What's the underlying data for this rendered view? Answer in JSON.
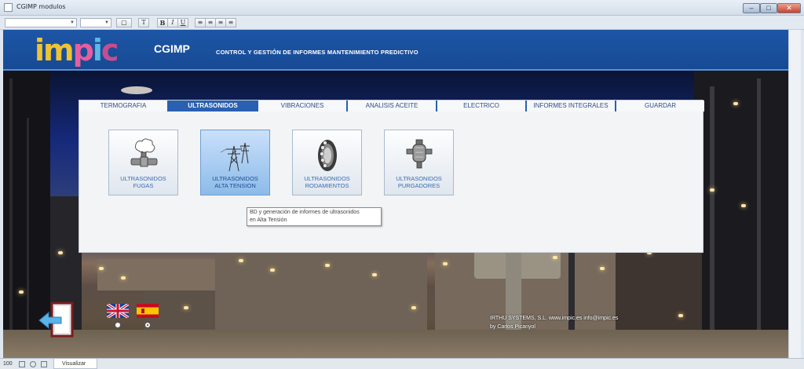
{
  "window": {
    "title": "CGIMP modulos"
  },
  "header": {
    "logo_parts": [
      "im",
      "p",
      "i",
      "c"
    ],
    "app_name": "CGIMP",
    "subtitle": "CONTROL Y GESTIÓN DE INFORMES MANTENIMIENTO PREDICTIVO"
  },
  "tabs": [
    {
      "label": "TERMOGRAFIA",
      "active": false
    },
    {
      "label": "ULTRASONIDOS",
      "active": true
    },
    {
      "label": "VIBRACIONES",
      "active": false
    },
    {
      "label": "ANALISIS ACEITE",
      "active": false
    },
    {
      "label": "ELECTRICO",
      "active": false
    },
    {
      "label": "INFORMES INTEGRALES",
      "active": false
    },
    {
      "label": "GUARDAR",
      "active": false
    }
  ],
  "tiles": [
    {
      "line1": "ULTRASONIDOS",
      "line2": "FUGAS",
      "icon": "leak-icon"
    },
    {
      "line1": "ULTRASONIDOS",
      "line2": "ALTA TENSION",
      "icon": "power-tower-icon"
    },
    {
      "line1": "ULTRASONIDOS",
      "line2": "RODAMIENTOS",
      "icon": "bearing-icon"
    },
    {
      "line1": "ULTRASONIDOS",
      "line2": "PURGADORES",
      "icon": "steam-trap-icon"
    }
  ],
  "tooltip": {
    "line1": "BD y generación de informes de ultrasonidos",
    "line2": "en Alta Tensión"
  },
  "credits": {
    "line1": "IRTHU SYSTEMS, S.L.        www.impic.es       info@impic.es",
    "line2": "by  Carlos Picanyol"
  },
  "statusbar": {
    "zoom": "100",
    "view_tab": "Visualizar"
  },
  "colors": {
    "header_blue": "#1d56a6",
    "tab_active": "#2a60b0",
    "tile_hover": "#8cbbe9"
  }
}
